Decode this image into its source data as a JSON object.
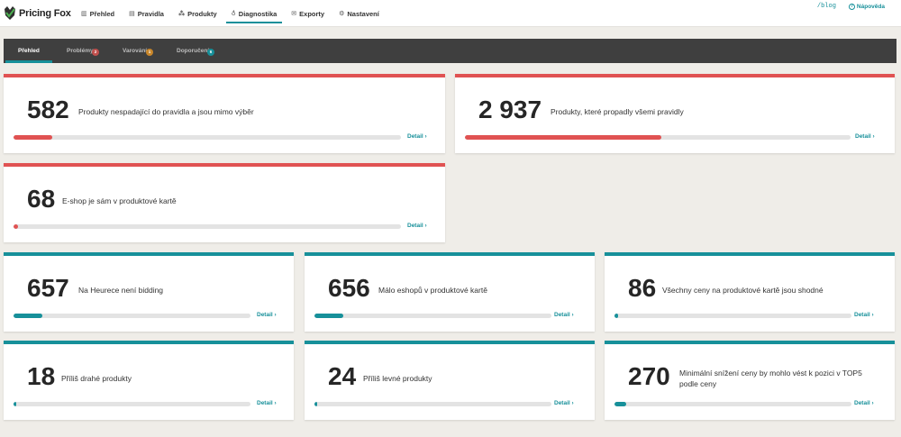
{
  "app": {
    "name": "Pricing Fox"
  },
  "nav": {
    "items": [
      {
        "label": "Přehled",
        "icon": "chart-icon"
      },
      {
        "label": "Pravidla",
        "icon": "table-icon"
      },
      {
        "label": "Produkty",
        "icon": "products-icon"
      },
      {
        "label": "Diagnostika",
        "icon": "stethoscope-icon",
        "active": true
      },
      {
        "label": "Exporty",
        "icon": "envelope-icon"
      },
      {
        "label": "Nastavení",
        "icon": "gear-icon"
      }
    ],
    "blog": "/blog",
    "help": "Nápověda",
    "help_icon": "?"
  },
  "subtabs": {
    "items": [
      {
        "label": "Přehled",
        "active": true
      },
      {
        "label": "Problémy",
        "badge": "2",
        "badge_color": "#c0504d"
      },
      {
        "label": "Varování",
        "badge": "1",
        "badge_color": "#c8862a"
      },
      {
        "label": "Doporučení",
        "badge": "6",
        "badge_color": "#17909a"
      }
    ]
  },
  "colors": {
    "problem": "#e05252",
    "info": "#17909a",
    "accent": "#17909a"
  },
  "detail_label": "Detail",
  "cards": [
    {
      "value": "582",
      "text": "Produkty nespadající do pravidla a jsou mimo výběr",
      "progress": 0.1,
      "type": "problem"
    },
    {
      "value": "2 937",
      "text": "Produkty, které propadly všemi pravidly",
      "progress": 0.51,
      "type": "problem"
    },
    {
      "value": "68",
      "text": "E-shop je sám v produktové kartě",
      "progress": 0.012,
      "type": "problem"
    },
    {
      "value": "657",
      "text": "Na Heurece není bidding",
      "progress": 0.12,
      "type": "info"
    },
    {
      "value": "656",
      "text": "Málo eshopů v produktové kartě",
      "progress": 0.12,
      "type": "info"
    },
    {
      "value": "86",
      "text": "Všechny ceny na produktové kartě jsou shodné",
      "progress": 0.016,
      "type": "info"
    },
    {
      "value": "18",
      "text": "Příliš drahé produkty",
      "progress": 0.004,
      "type": "info"
    },
    {
      "value": "24",
      "text": "Příliš levné produkty",
      "progress": 0.004,
      "type": "info"
    },
    {
      "value": "270",
      "text": "Minimální snížení ceny by mohlo vést k pozici v TOP5 podle ceny",
      "progress": 0.05,
      "type": "info"
    }
  ]
}
